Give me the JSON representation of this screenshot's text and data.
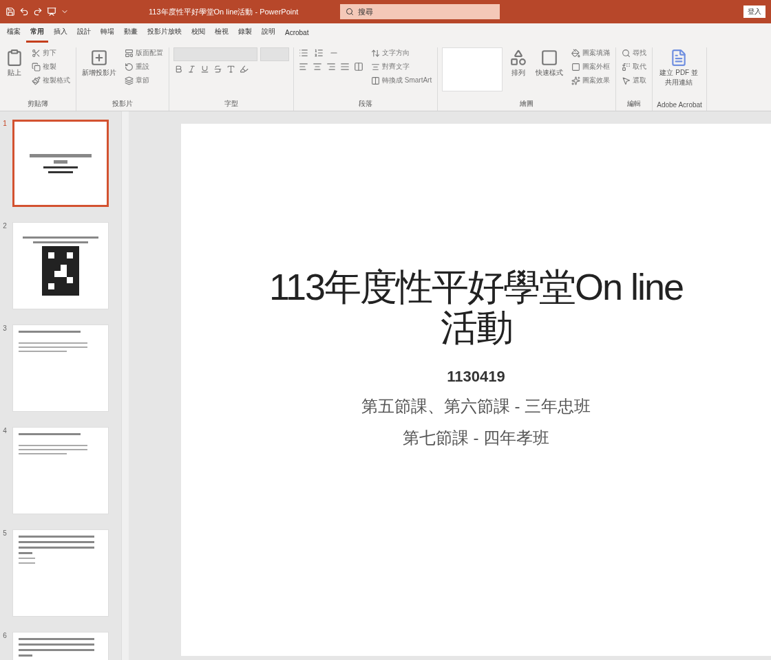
{
  "window": {
    "title": "113年度性平好學堂On line活動 - PowerPoint"
  },
  "search": {
    "placeholder": "搜尋"
  },
  "account": {
    "label": "登入"
  },
  "tabs": [
    {
      "label": "檔案",
      "selected": false
    },
    {
      "label": "常用",
      "selected": true
    },
    {
      "label": "插入",
      "selected": false
    },
    {
      "label": "設計",
      "selected": false
    },
    {
      "label": "轉場",
      "selected": false
    },
    {
      "label": "動畫",
      "selected": false
    },
    {
      "label": "投影片放映",
      "selected": false
    },
    {
      "label": "校閱",
      "selected": false
    },
    {
      "label": "檢視",
      "selected": false
    },
    {
      "label": "錄製",
      "selected": false
    },
    {
      "label": "說明",
      "selected": false
    },
    {
      "label": "Acrobat",
      "selected": false
    }
  ],
  "ribbon": [
    {
      "label": "剪貼簿",
      "items": [
        {
          "kind": "large",
          "label": "貼上"
        },
        {
          "kind": "small",
          "label": "剪下"
        },
        {
          "kind": "small",
          "label": "複製"
        },
        {
          "kind": "small",
          "label": "複製格式"
        }
      ]
    },
    {
      "label": "投影片",
      "items": [
        {
          "kind": "large",
          "label": "新增投影片"
        },
        {
          "kind": "small",
          "label": "版面配置"
        },
        {
          "kind": "small",
          "label": "重設"
        },
        {
          "kind": "small",
          "label": "章節"
        }
      ]
    },
    {
      "label": "字型",
      "items": [
        {
          "kind": "font"
        }
      ]
    },
    {
      "label": "段落",
      "items": [
        {
          "kind": "para"
        },
        {
          "kind": "small",
          "label": "文字方向"
        },
        {
          "kind": "small",
          "label": "對齊文字"
        },
        {
          "kind": "small",
          "label": "轉換成 SmartArt"
        }
      ]
    },
    {
      "label": "繪圖",
      "items": [
        {
          "kind": "shapes"
        },
        {
          "kind": "large",
          "label": "排列"
        },
        {
          "kind": "large",
          "label": "快速樣式"
        },
        {
          "kind": "small",
          "label": "圖案填滿"
        },
        {
          "kind": "small",
          "label": "圖案外框"
        },
        {
          "kind": "small",
          "label": "圖案效果"
        }
      ]
    },
    {
      "label": "編輯",
      "items": [
        {
          "kind": "small",
          "label": "尋找"
        },
        {
          "kind": "small",
          "label": "取代"
        },
        {
          "kind": "small",
          "label": "選取"
        }
      ]
    },
    {
      "label": "Adobe Acrobat",
      "items": [
        {
          "kind": "large",
          "label": "建立 PDF 並共用連結"
        }
      ]
    }
  ],
  "slides": [
    {
      "number": "1",
      "kind": "title",
      "selected": true
    },
    {
      "number": "2",
      "kind": "qr",
      "selected": false
    },
    {
      "number": "3",
      "kind": "bullets",
      "selected": false
    },
    {
      "number": "4",
      "kind": "bullets",
      "selected": false
    },
    {
      "number": "5",
      "kind": "text",
      "selected": false
    },
    {
      "number": "6",
      "kind": "text",
      "selected": false
    }
  ],
  "slide": {
    "title": "113年度性平好學堂On line 活動",
    "date": "1130419",
    "lines": [
      "第五節課、第六節課 - 三年忠班",
      "第七節課 - 四年孝班"
    ]
  }
}
